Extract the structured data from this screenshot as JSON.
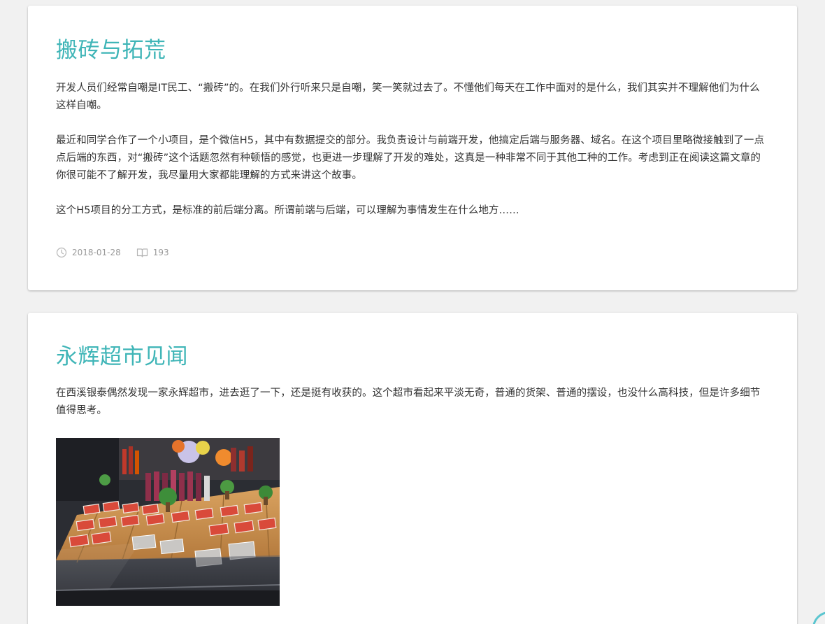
{
  "posts": [
    {
      "title": "搬砖与拓荒",
      "paragraphs": [
        "开发人员们经常自嘲是IT民工、“搬砖”的。在我们外行听来只是自嘲，笑一笑就过去了。不懂他们每天在工作中面对的是什么，我们其实并不理解他们为什么这样自嘲。",
        "最近和同学合作了一个小项目，是个微信H5，其中有数据提交的部分。我负责设计与前端开发，他搞定后端与服务器、域名。在这个项目里略微接触到了一点点后端的东西，对“搬砖”这个话题忽然有种顿悟的感觉，也更进一步理解了开发的难处，这真是一种非常不同于其他工种的工作。考虑到正在阅读这篇文章的你很可能不了解开发，我尽量用大家都能理解的方式来讲这个故事。",
        "这个H5项目的分工方式，是标准的前后端分离。所谓前端与后端，可以理解为事情发生在什么地方……"
      ],
      "date": "2018-01-28",
      "reads": "193",
      "date_icon": "clock-icon",
      "reads_icon": "book-icon"
    },
    {
      "title": "永辉超市见闻",
      "paragraphs": [
        "在西溪银泰偶然发现一家永辉超市，进去逛了一下，还是挺有收获的。这个超市看起来平淡无奇，普通的货架、普通的摆设，也没什么高科技，但是许多细节值得思考。"
      ],
      "image": "supermarket-seafood-counter-photo"
    }
  ],
  "colors": {
    "title": "#3fb5b7",
    "text": "#333333",
    "meta": "#9a9a9a",
    "background": "#f1f1f1",
    "card": "#ffffff"
  }
}
